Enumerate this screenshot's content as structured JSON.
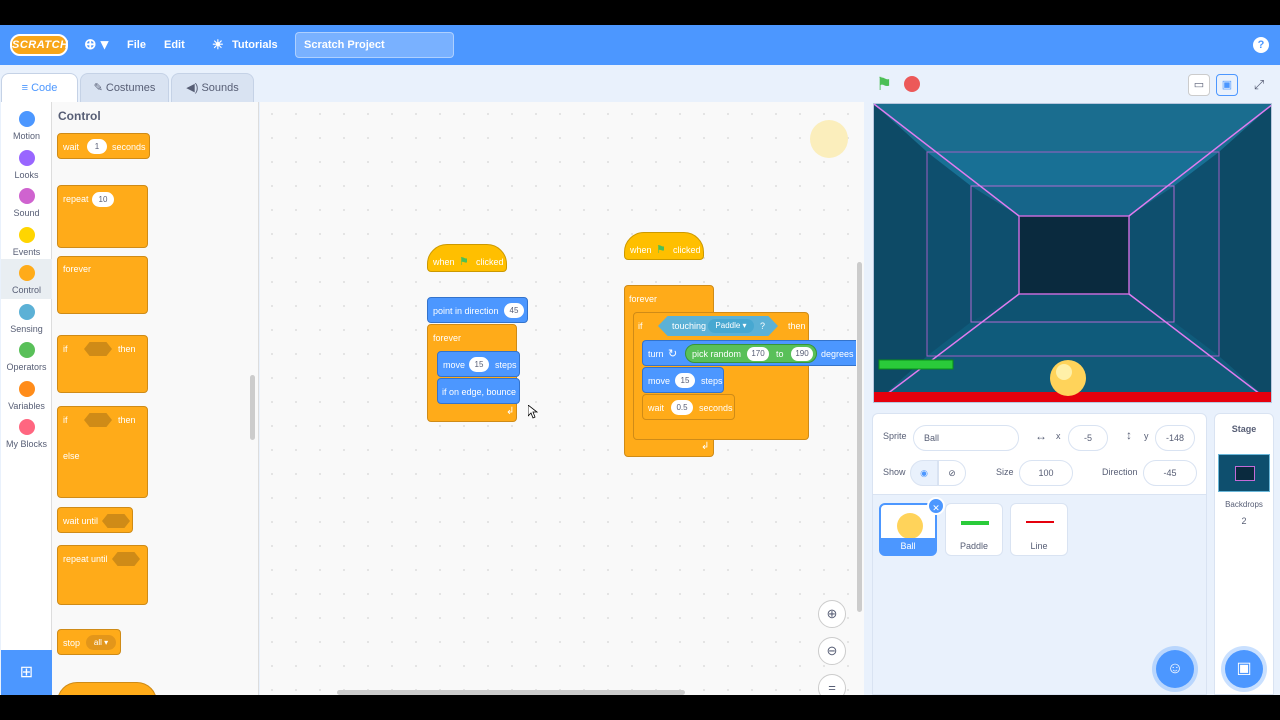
{
  "menubar": {
    "logo": "SCRATCH",
    "file": "File",
    "edit": "Edit",
    "tutorials": "Tutorials",
    "project_title": "Scratch Project"
  },
  "tabs": {
    "code": "Code",
    "costumes": "Costumes",
    "sounds": "Sounds"
  },
  "categories": [
    {
      "label": "Motion",
      "color": "#4c97ff"
    },
    {
      "label": "Looks",
      "color": "#9966ff"
    },
    {
      "label": "Sound",
      "color": "#cf63cf"
    },
    {
      "label": "Events",
      "color": "#ffd500"
    },
    {
      "label": "Control",
      "color": "#ffab19"
    },
    {
      "label": "Sensing",
      "color": "#5cb1d6"
    },
    {
      "label": "Operators",
      "color": "#59c059"
    },
    {
      "label": "Variables",
      "color": "#ff8c1a"
    },
    {
      "label": "My Blocks",
      "color": "#ff6680"
    }
  ],
  "palette": {
    "title": "Control",
    "wait": "wait",
    "wait_val": "1",
    "seconds": "seconds",
    "repeat": "repeat",
    "repeat_val": "10",
    "forever": "forever",
    "if": "if",
    "then": "then",
    "else": "else",
    "wait_until": "wait until",
    "repeat_until": "repeat until",
    "stop": "stop",
    "stop_val": "all ▾"
  },
  "script1": {
    "when": "when",
    "clicked": "clicked",
    "point": "point in direction",
    "point_val": "45",
    "forever": "forever",
    "move": "move",
    "move_val": "15",
    "steps": "steps",
    "bounce": "if on edge, bounce"
  },
  "script2": {
    "when": "when",
    "clicked": "clicked",
    "forever": "forever",
    "if": "if",
    "touching": "touching",
    "touching_val": "Paddle ▾",
    "q": "?",
    "then": "then",
    "turn": "turn",
    "pick_random": "pick random",
    "from": "170",
    "to": "to",
    "to_val": "190",
    "degrees": "degrees",
    "move": "move",
    "move_val": "15",
    "steps": "steps",
    "wait": "wait",
    "wait_val": "0.5",
    "seconds": "seconds"
  },
  "sprite_info": {
    "sprite_label": "Sprite",
    "sprite_name": "Ball",
    "x_label": "x",
    "x_val": "-5",
    "y_label": "y",
    "y_val": "-148",
    "show_label": "Show",
    "size_label": "Size",
    "size_val": "100",
    "dir_label": "Direction",
    "dir_val": "-45"
  },
  "sprites": [
    {
      "name": "Ball"
    },
    {
      "name": "Paddle"
    },
    {
      "name": "Line"
    }
  ],
  "stage_panel": {
    "title": "Stage",
    "backdrops_label": "Backdrops",
    "backdrops_count": "2"
  },
  "colors": {
    "accent": "#4c97ff",
    "control": "#ffab19",
    "motion": "#4c97ff",
    "operators": "#59c059",
    "sensing": "#5cb1d6"
  }
}
